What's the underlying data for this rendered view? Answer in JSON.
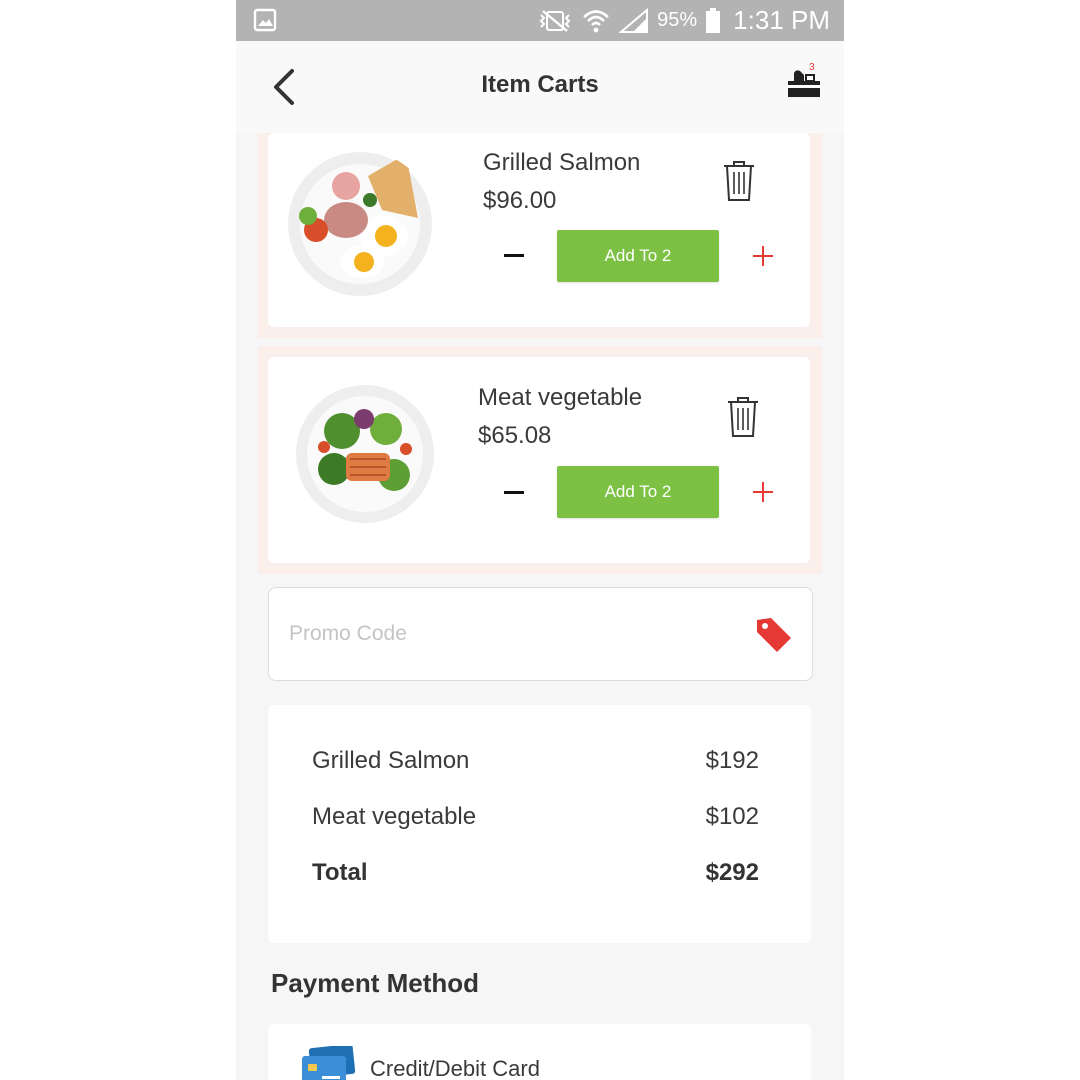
{
  "status_bar": {
    "battery": "95%",
    "time": "1:31 PM",
    "icons": [
      "gallery-icon",
      "vibrate-icon",
      "wifi-icon",
      "signal-icon",
      "battery-icon"
    ]
  },
  "header": {
    "title": "Item Carts",
    "cart_count": "3"
  },
  "items": [
    {
      "name": "Grilled Salmon",
      "price": "$96.00",
      "button_label": "Add To 2"
    },
    {
      "name": "Meat vegetable",
      "price": "$65.08",
      "button_label": "Add To 2"
    }
  ],
  "promo": {
    "placeholder": "Promo Code"
  },
  "summary": {
    "rows": [
      {
        "label": "Grilled Salmon",
        "value": "$192"
      },
      {
        "label": "Meat vegetable",
        "value": "$102"
      }
    ],
    "total_label": "Total",
    "total_value": "$292"
  },
  "payment": {
    "heading": "Payment Method",
    "options": [
      {
        "label": "Credit/Debit Card"
      }
    ]
  },
  "colors": {
    "accent_green": "#7cc143",
    "accent_red": "#e53935",
    "status_bar": "#b3b3b3"
  }
}
